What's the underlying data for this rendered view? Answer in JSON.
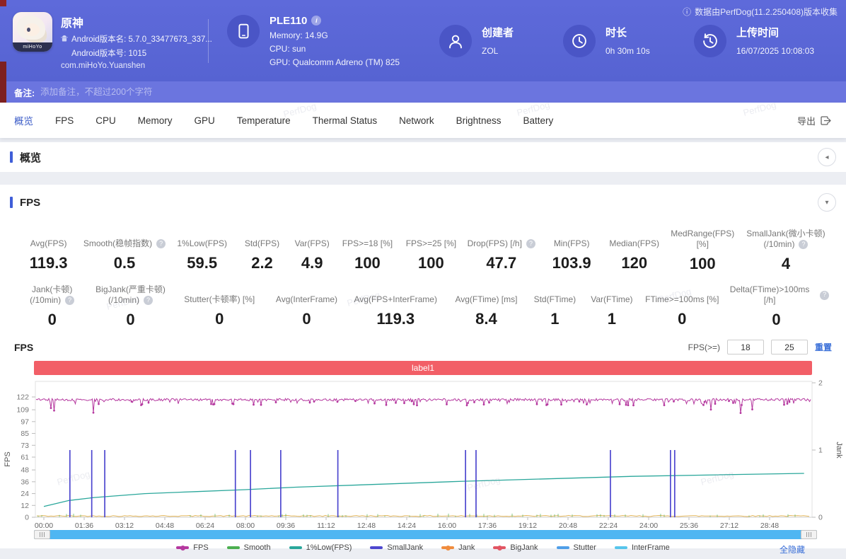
{
  "watermark": "PerfDog",
  "header": {
    "app": {
      "name": "原神",
      "android_version_name": "Android版本名: 5.7.0_33477673_337...",
      "android_version_code": "Android版本号: 1015",
      "package": "com.miHoYo.Yuanshen",
      "icon_brand": "miHoYo"
    },
    "device": {
      "name": "PLE110",
      "memory": "Memory: 14.9G",
      "cpu": "CPU: sun",
      "gpu": "GPU: Qualcomm Adreno (TM) 825"
    },
    "creator": {
      "label": "创建者",
      "value": "ZOL"
    },
    "duration": {
      "label": "时长",
      "value": "0h 30m 10s"
    },
    "upload": {
      "label": "上传时间",
      "value": "16/07/2025 10:08:03"
    },
    "collect_note": "数据由PerfDog(11.2.250408)版本收集"
  },
  "note_bar": {
    "label": "备注:",
    "placeholder": "添加备注，不超过200个字符"
  },
  "tabs": [
    {
      "label": "概览",
      "active": true
    },
    {
      "label": "FPS",
      "active": false
    },
    {
      "label": "CPU",
      "active": false
    },
    {
      "label": "Memory",
      "active": false
    },
    {
      "label": "GPU",
      "active": false
    },
    {
      "label": "Temperature",
      "active": false
    },
    {
      "label": "Thermal Status",
      "active": false
    },
    {
      "label": "Network",
      "active": false
    },
    {
      "label": "Brightness",
      "active": false
    },
    {
      "label": "Battery",
      "active": false
    }
  ],
  "export_label": "导出",
  "sections": {
    "overview_title": "概览",
    "fps_title": "FPS"
  },
  "fps_metrics": {
    "row1": [
      {
        "label": "Avg(FPS)",
        "value": "119.3",
        "help": false
      },
      {
        "label": "Smooth(稳帧指数)",
        "value": "0.5",
        "help": true
      },
      {
        "label": "1%Low(FPS)",
        "value": "59.5",
        "help": false
      },
      {
        "label": "Std(FPS)",
        "value": "2.2",
        "help": false
      },
      {
        "label": "Var(FPS)",
        "value": "4.9",
        "help": false
      },
      {
        "label": "FPS>=18 [%]",
        "value": "100",
        "help": false
      },
      {
        "label": "FPS>=25 [%]",
        "value": "100",
        "help": false
      },
      {
        "label": "Drop(FPS) [/h]",
        "value": "47.7",
        "help": true
      },
      {
        "label": "Min(FPS)",
        "value": "103.9",
        "help": false
      },
      {
        "label": "Median(FPS)",
        "value": "120",
        "help": false
      },
      {
        "label": "MedRange(FPS)[%]",
        "value": "100",
        "help": false
      },
      {
        "label": "SmallJank(微小卡顿)\n(/10min)",
        "value": "4",
        "help": true
      }
    ],
    "row2": [
      {
        "label": "Jank(卡顿)\n(/10min)",
        "value": "0",
        "help": true
      },
      {
        "label": "BigJank(严重卡顿)\n(/10min)",
        "value": "0",
        "help": true
      },
      {
        "label": "Stutter(卡顿率) [%]",
        "value": "0",
        "help": false
      },
      {
        "label": "Avg(InterFrame)",
        "value": "0",
        "help": false
      },
      {
        "label": "Avg(FPS+InterFrame)",
        "value": "119.3",
        "help": false
      },
      {
        "label": "Avg(FTime) [ms]",
        "value": "8.4",
        "help": false
      },
      {
        "label": "Std(FTime)",
        "value": "1",
        "help": false
      },
      {
        "label": "Var(FTime)",
        "value": "1",
        "help": false
      },
      {
        "label": "FTime>=100ms [%]",
        "value": "0",
        "help": false
      },
      {
        "label": "Delta(FTime)>100ms [/h]",
        "value": "0",
        "help": true
      }
    ]
  },
  "chart_controls": {
    "section_label": "FPS",
    "threshold_label": "FPS(>=)",
    "input1": "18",
    "input2": "25",
    "reset_label": "重置",
    "hide_all_label": "全隐藏"
  },
  "chart_data": {
    "type": "line",
    "banner": {
      "label": "label1",
      "color": "#f25f67"
    },
    "duration_sec": 1810,
    "x_tick_interval_sec": 96,
    "x_ticks": [
      "00:00",
      "01:36",
      "03:12",
      "04:48",
      "06:24",
      "08:00",
      "09:36",
      "11:12",
      "12:48",
      "14:24",
      "16:00",
      "17:36",
      "19:12",
      "20:48",
      "22:24",
      "24:00",
      "25:36",
      "27:12",
      "28:48"
    ],
    "y_left": {
      "label": "FPS",
      "ticks": [
        0,
        12,
        24,
        36,
        48,
        61,
        73,
        85,
        97,
        109,
        122
      ],
      "max_tick": 122
    },
    "y_right": {
      "label": "Jank",
      "ticks": [
        0,
        1,
        2
      ],
      "max_tick": 2
    },
    "series": [
      {
        "name": "FPS",
        "color": "#b5389f",
        "type": "noisy-line",
        "baseline": 120.4,
        "avg": 119.3,
        "median": 120,
        "min": 103.9,
        "dip_band": [
          112,
          118
        ],
        "deep_dip_band": [
          104,
          111
        ]
      },
      {
        "name": "Smooth",
        "color": "#4caf50",
        "type": "noise-floor",
        "level": 0.5
      },
      {
        "name": "1%Low(FPS)",
        "color": "#2aa79b",
        "type": "curve",
        "points_sec_fps": [
          [
            0,
            11
          ],
          [
            60,
            17
          ],
          [
            120,
            20
          ],
          [
            240,
            24
          ],
          [
            360,
            26
          ],
          [
            480,
            28
          ],
          [
            600,
            30.5
          ],
          [
            800,
            33.5
          ],
          [
            1000,
            36.5
          ],
          [
            1200,
            39
          ],
          [
            1400,
            41.5
          ],
          [
            1600,
            43
          ],
          [
            1810,
            44.5
          ]
        ]
      },
      {
        "name": "SmallJank",
        "color": "#4d47cf",
        "type": "event-spikes",
        "axis": "jank",
        "spike_value": 1,
        "times_sec": [
          62,
          114,
          145,
          456,
          492,
          564,
          700,
          1004,
          1029,
          1349,
          1492,
          1502
        ]
      },
      {
        "name": "Jank",
        "color": "#e0ae48",
        "type": "flat",
        "level": 0
      },
      {
        "name": "BigJank",
        "color": "#e25563",
        "type": "flat",
        "level": 0
      },
      {
        "name": "Stutter",
        "color": "#4f9ee8",
        "type": "flat",
        "level": 0
      },
      {
        "name": "InterFrame",
        "color": "#57c5ec",
        "type": "flat",
        "level": 0
      }
    ],
    "legend": [
      {
        "label": "FPS",
        "color": "#b5389f",
        "dot": true
      },
      {
        "label": "Smooth",
        "color": "#4caf50",
        "dot": false
      },
      {
        "label": "1%Low(FPS)",
        "color": "#2aa79b",
        "dot": false
      },
      {
        "label": "SmallJank",
        "color": "#4d47cf",
        "dot": false
      },
      {
        "label": "Jank",
        "color": "#f08c3e",
        "dot": true
      },
      {
        "label": "BigJank",
        "color": "#e25563",
        "dot": true
      },
      {
        "label": "Stutter",
        "color": "#4f9ee8",
        "dot": false
      },
      {
        "label": "InterFrame",
        "color": "#57c5ec",
        "dot": false
      }
    ],
    "grid": false,
    "legend_position": "bottom-center"
  }
}
